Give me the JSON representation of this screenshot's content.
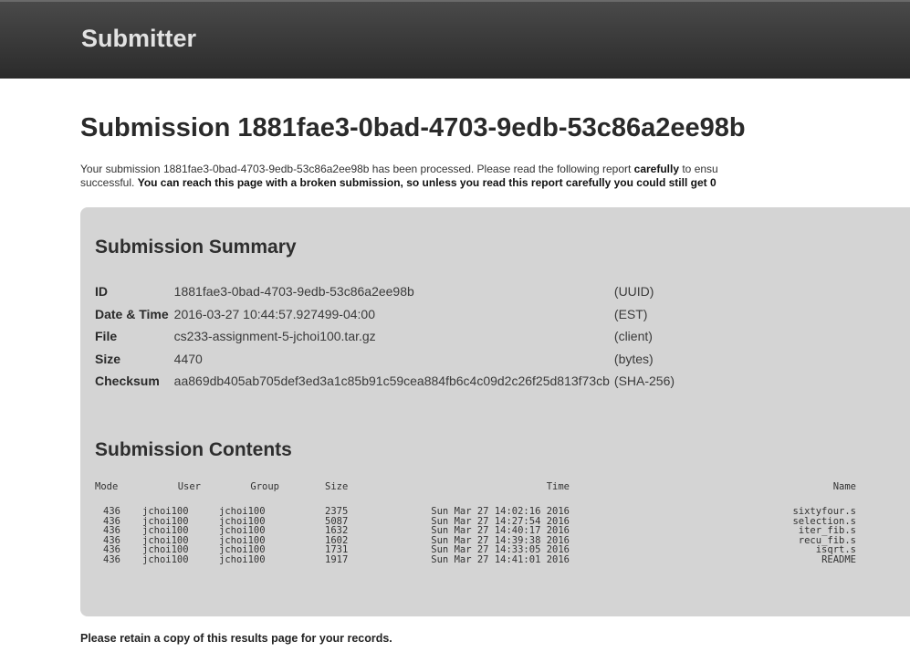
{
  "header": {
    "brand": "Submitter"
  },
  "page": {
    "title": "Submission 1881fae3-0bad-4703-9edb-53c86a2ee98b",
    "intro_part1": "Your submission 1881fae3-0bad-4703-9edb-53c86a2ee98b has been processed. Please read the following report ",
    "intro_bold1": "carefully",
    "intro_part2": " to ensu",
    "intro_part3": "successful. ",
    "intro_bold2": "You can reach this page with a broken submission, so unless you read this report carefully you could still get 0",
    "footnote": "Please retain a copy of this results page for your records."
  },
  "summary": {
    "heading": "Submission Summary",
    "rows": [
      {
        "label": "ID",
        "value": "1881fae3-0bad-4703-9edb-53c86a2ee98b",
        "note": "(UUID)"
      },
      {
        "label": "Date & Time",
        "value": "2016-03-27 10:44:57.927499-04:00",
        "note": "(EST)"
      },
      {
        "label": "File",
        "value": "cs233-assignment-5-jchoi100.tar.gz",
        "note": "(client)"
      },
      {
        "label": "Size",
        "value": "4470",
        "note": "(bytes)"
      },
      {
        "label": "Checksum",
        "value": "aa869db405ab705def3ed3a1c85b91c59cea884fb6c4c09d2c26f25d813f73cb",
        "note": "(SHA-256)"
      }
    ]
  },
  "contents": {
    "heading": "Submission Contents",
    "columns": [
      "Mode",
      "User",
      "Group",
      "Size",
      "Time",
      "Name"
    ],
    "files": [
      {
        "mode": "436",
        "user": "jchoi100",
        "group": "jchoi100",
        "size": "2375",
        "time": "Sun Mar 27 14:02:16 2016",
        "name": "sixtyfour.s"
      },
      {
        "mode": "436",
        "user": "jchoi100",
        "group": "jchoi100",
        "size": "5087",
        "time": "Sun Mar 27 14:27:54 2016",
        "name": "selection.s"
      },
      {
        "mode": "436",
        "user": "jchoi100",
        "group": "jchoi100",
        "size": "1632",
        "time": "Sun Mar 27 14:40:17 2016",
        "name": "iter_fib.s"
      },
      {
        "mode": "436",
        "user": "jchoi100",
        "group": "jchoi100",
        "size": "1602",
        "time": "Sun Mar 27 14:39:38 2016",
        "name": "recu_fib.s"
      },
      {
        "mode": "436",
        "user": "jchoi100",
        "group": "jchoi100",
        "size": "1731",
        "time": "Sun Mar 27 14:33:05 2016",
        "name": "isqrt.s"
      },
      {
        "mode": "436",
        "user": "jchoi100",
        "group": "jchoi100",
        "size": "1917",
        "time": "Sun Mar 27 14:41:01 2016",
        "name": "README"
      }
    ]
  }
}
